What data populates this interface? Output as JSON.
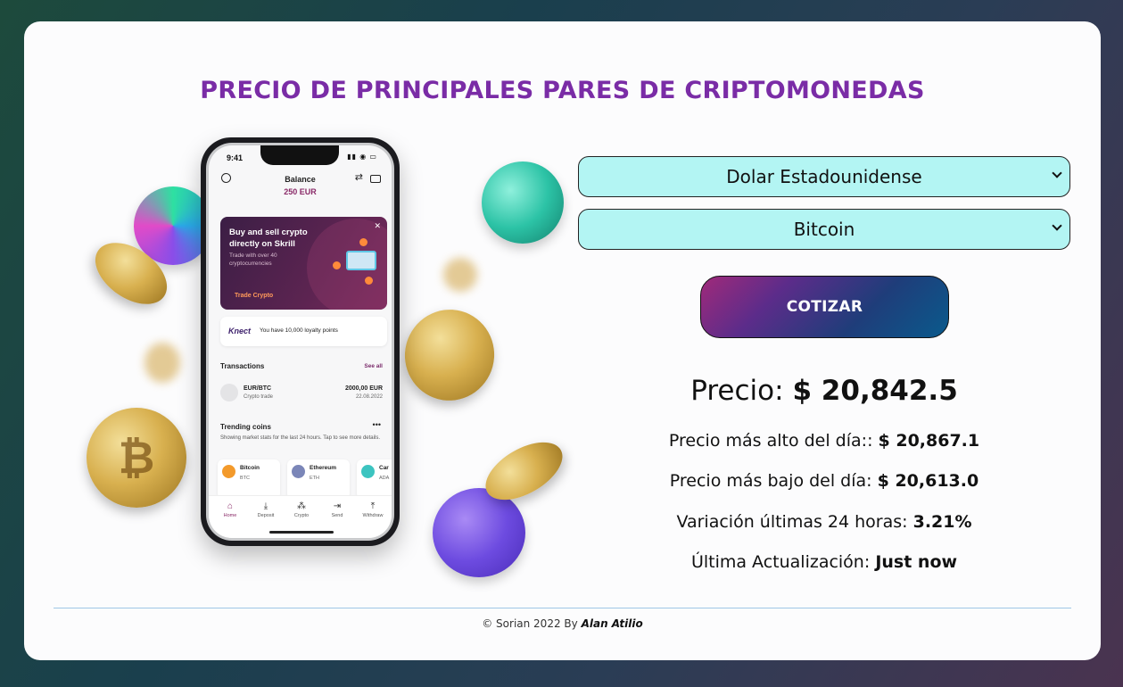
{
  "title": "PRECIO DE PRINCIPALES PARES DE CRIPTOMONEDAS",
  "form": {
    "currency": {
      "selected": "Dolar Estadounidense"
    },
    "crypto": {
      "selected": "Bitcoin"
    },
    "submit_label": "COTIZAR"
  },
  "result": {
    "price_label": "Precio:",
    "price_value": "$ 20,842.5",
    "high_label": "Precio más alto del día::",
    "high_value": "$ 20,867.1",
    "low_label": "Precio más bajo del día:",
    "low_value": "$ 20,613.0",
    "change_label": "Variación últimas 24 horas:",
    "change_value": "3.21%",
    "updated_label": "Última Actualización:",
    "updated_value": "Just now"
  },
  "footer": {
    "text": "© Sorian 2022 By",
    "author": "Alan Atilio"
  },
  "phone": {
    "time": "9:41",
    "balance_label": "Balance",
    "balance_amount": "250 EUR",
    "promo_title": "Buy and sell crypto directly on Skrill",
    "promo_sub": "Trade with over 40 cryptocurrencies",
    "promo_cta": "Trade Crypto",
    "knect_logo": "Knect",
    "knect_text": "You have 10,000 loyalty points",
    "transactions_label": "Transactions",
    "see_all": "See all",
    "tx_pair": "EUR/BTC",
    "tx_type": "Crypto trade",
    "tx_amount": "2000,00 EUR",
    "tx_date": "22.08.2022",
    "trending_label": "Trending coins",
    "trending_desc": "Showing market stats for the last 24 hours. Tap to see more details.",
    "coins": [
      {
        "name": "Bitcoin",
        "symbol": "BTC",
        "color": "#f39a2b"
      },
      {
        "name": "Ethereum",
        "symbol": "ETH",
        "color": "#7b86b8"
      },
      {
        "name": "Car",
        "symbol": "ADA",
        "color": "#3cc4c0"
      }
    ],
    "tabs": [
      "Home",
      "Deposit",
      "Crypto",
      "Send",
      "Withdraw"
    ]
  }
}
